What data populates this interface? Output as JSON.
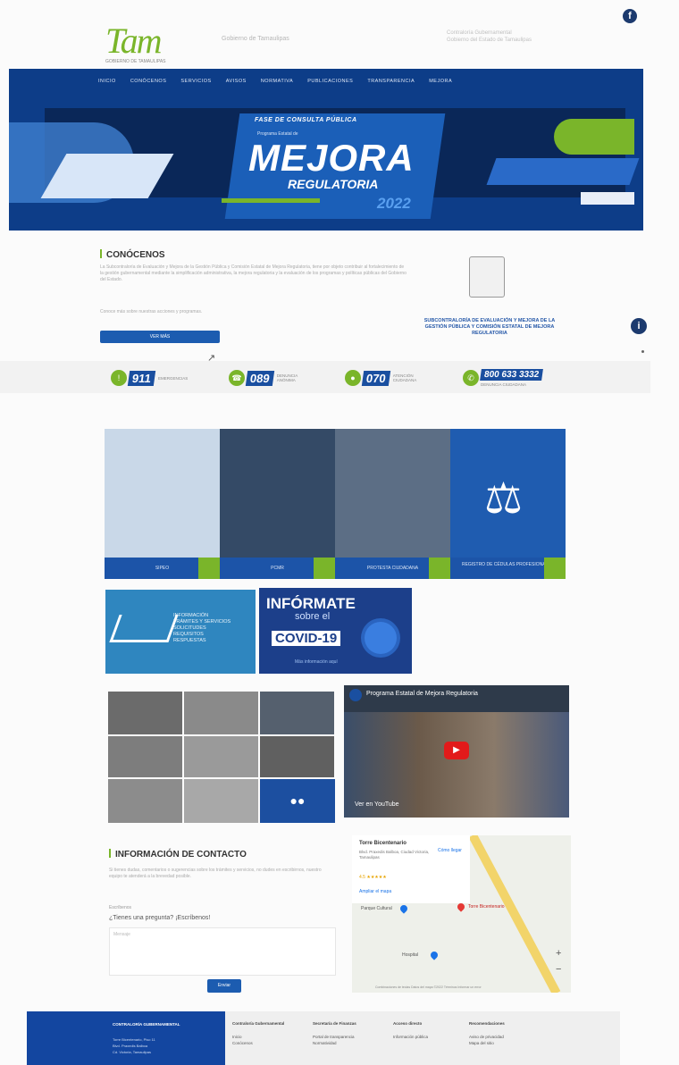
{
  "header": {
    "logo_text": "Tam",
    "logo_sub": "GOBIERNO DE TAMAULIPAS",
    "tagline": "Gobierno de Tamaulipas",
    "right_line1": "Contraloría Gubernamental",
    "right_line2": "Gobierno del Estado de Tamaulipas"
  },
  "nav": {
    "items": [
      "INICIO",
      "CONÓCENOS",
      "SERVICIOS",
      "AVISOS",
      "NORMATIVA",
      "PUBLICACIONES",
      "TRANSPARENCIA",
      "MEJORA"
    ]
  },
  "banner": {
    "line1": "FASE DE CONSULTA PÚBLICA",
    "line2": "Programa Estatal de",
    "title": "MEJORA",
    "subtitle": "REGULATORIA",
    "year": "2022"
  },
  "about": {
    "title": "CONÓCENOS",
    "text": "La Subcontraloría de Evaluación y Mejora de la Gestión Pública y Comisión Estatal de Mejora Regulatoria, tiene por objeto contribuir al fortalecimiento de la gestión gubernamental mediante la simplificación administrativa, la mejora regulatoria y la evaluación de los programas y políticas públicas del Gobierno del Estado.",
    "text2": "Conoce más sobre nuestras acciones y programas.",
    "button": "VER MÁS",
    "seal_caption": "SUBCONTRALORÍA DE EVALUACIÓN Y MEJORA DE LA GESTIÓN PÚBLICA Y COMISIÓN ESTATAL DE MEJORA REGULATORIA"
  },
  "emergency": [
    {
      "number": "911",
      "label": "EMERGENCIAS",
      "icon": "alert-icon"
    },
    {
      "number": "089",
      "label": "DENUNCIA ANÓNIMA",
      "icon": "phone-icon"
    },
    {
      "number": "070",
      "label": "ATENCIÓN CIUDADANA",
      "icon": "user-icon"
    },
    {
      "number": "800 633 3332",
      "label": "DENUNCIA CIUDADANA",
      "icon": "headset-icon"
    }
  ],
  "tiles": [
    {
      "label": "SIPEO",
      "color": "#c9d8e8"
    },
    {
      "label": "PCMR",
      "color": "#344a66"
    },
    {
      "label": "PROTESTA CIUDADANA",
      "color": "#5c6e85"
    },
    {
      "label": "REGISTRO DE CÉDULAS PROFESIONALES",
      "color": "#1f5cb0"
    }
  ],
  "promo1": {
    "items": [
      "INFORMACIÓN",
      "TRÁMITES Y SERVICIOS",
      "SOLICITUDES",
      "REQUISITOS",
      "RESPUESTAS"
    ]
  },
  "promo2": {
    "line1": "INFÓRMATE",
    "line2": "sobre el",
    "line3": "COVID-19",
    "line4": "Más información aquí"
  },
  "video": {
    "title": "Programa Estatal de Mejora Regulatoria",
    "footer": "Ver en YouTube"
  },
  "contact": {
    "title": "INFORMACIÓN DE CONTACTO",
    "text": "Si tienes dudas, comentarios o sugerencias sobre los trámites y servicios, no dudes en escribirnos, nuestro equipo te atenderá a la brevedad posible.",
    "label": "Escríbenos",
    "question": "¿Tienes una pregunta? ¡Escríbenos!",
    "placeholder": "Mensaje",
    "send": "Enviar"
  },
  "map": {
    "place": "Torre Bicentenario",
    "address": "Blvd. Praxedis Balboa, Ciudad Victoria, Tamaulipas",
    "rating": "4.5 ★★★★★",
    "link": "Ampliar el mapa",
    "directions": "Cómo llegar",
    "pin_label": "Torre Bicentenario",
    "label2": "Parque Cultural",
    "label3": "Hospital",
    "attribution": "Combinaciones de teclas  Datos del mapa ©2022  Términos  Informar un error"
  },
  "footer": {
    "blue_title": "CONTRALORÍA GUBERNAMENTAL",
    "blue_lines": [
      "Torre Bicentenario, Piso 11",
      "Blvd. Praxedis Balboa",
      "Cd. Victoria, Tamaulipas"
    ],
    "col1_title": "Contraloría Gubernamental",
    "col1_items": [
      "Inicio",
      "Conócenos"
    ],
    "col2_title": "Secretaría de Finanzas",
    "col2_items": [
      "Portal de transparencia",
      "Normatividad"
    ],
    "col3_title": "Acceso directo",
    "col3_items": [
      "Información pública"
    ],
    "col4_title": "Recomendaciones",
    "col4_items": [
      "Aviso de privacidad",
      "Mapa del sitio"
    ]
  }
}
